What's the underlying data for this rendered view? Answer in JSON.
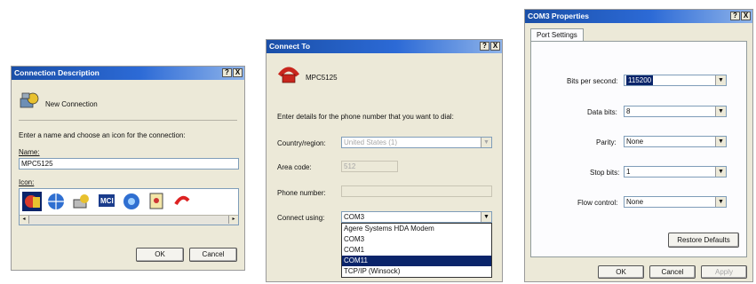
{
  "connection_description": {
    "title": "Connection Description",
    "help_btn": "?",
    "close_btn": "X",
    "header_text": "New Connection",
    "prompt": "Enter a name and choose an icon for the connection:",
    "name_label": "Name:",
    "name_value": "MPC5125",
    "icon_label": "Icon:",
    "ok": "OK",
    "cancel": "Cancel"
  },
  "connect_to": {
    "title": "Connect To",
    "help_btn": "?",
    "close_btn": "X",
    "connection_name": "MPC5125",
    "prompt": "Enter details for the phone number that you want to dial:",
    "country_label": "Country/region:",
    "country_value": "United States (1)",
    "area_label": "Area code:",
    "area_value": "512",
    "phone_label": "Phone number:",
    "phone_value": "",
    "connect_label": "Connect using:",
    "connect_value": "COM3",
    "dropdown_options": [
      "Agere Systems HDA Modem",
      "COM3",
      "COM1",
      "COM11",
      "TCP/IP (Winsock)"
    ],
    "selected_option": "COM11"
  },
  "com3_properties": {
    "title": "COM3 Properties",
    "help_btn": "?",
    "close_btn": "X",
    "tab": "Port Settings",
    "bits_label": "Bits per second:",
    "bits_value": "115200",
    "databits_label": "Data bits:",
    "databits_value": "8",
    "parity_label": "Parity:",
    "parity_value": "None",
    "stopbits_label": "Stop bits:",
    "stopbits_value": "1",
    "flow_label": "Flow control:",
    "flow_value": "None",
    "restore": "Restore Defaults",
    "ok": "OK",
    "cancel": "Cancel",
    "apply": "Apply"
  },
  "colors": {
    "titlebar": "#2c6ad6",
    "selection": "#0a246a",
    "face": "#ece9d8"
  }
}
